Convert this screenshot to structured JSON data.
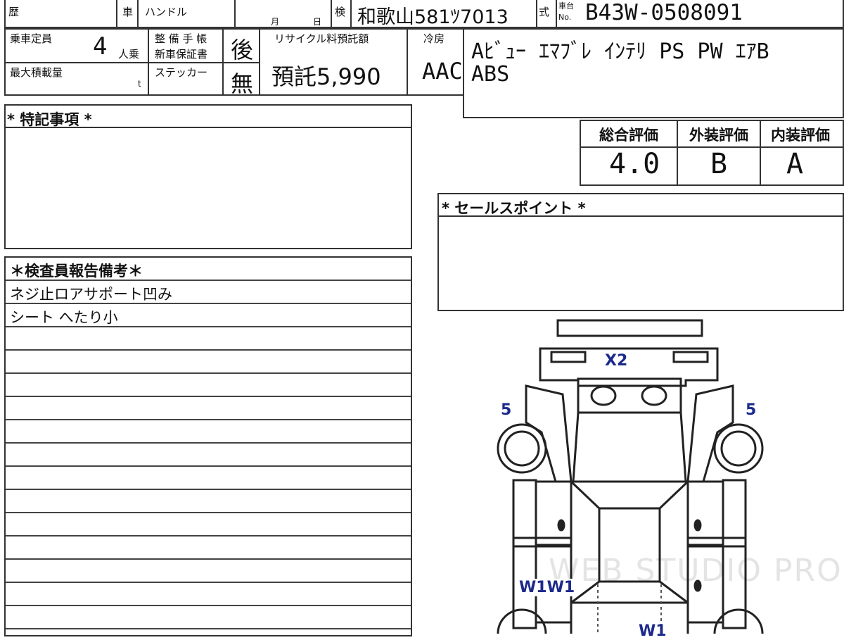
{
  "header": {
    "rireki_label": "歴",
    "car_label": "車",
    "handle_label": "ハンドル",
    "month_label": "月",
    "day_label": "日",
    "ken_label": "検",
    "plate": "和歌山581ﾂ7013",
    "shiki_label": "式",
    "chassis_label_top": "車台",
    "chassis_label_bottom": "No.",
    "chassis_no": "B43W-0508091"
  },
  "specs": {
    "capacity_label": "乗車定員",
    "capacity_value": "4",
    "capacity_unit": "人乗",
    "load_label": "最大積載量",
    "load_unit": "t",
    "maint_label_1": "整 備 手 帳",
    "maint_label_2": "新車保証書",
    "maint_value": "後",
    "sticker_label": "ステッカー",
    "sticker_value": "無",
    "recycle_label": "リサイクル料預託額",
    "recycle_value": "預託5,990",
    "aircon_label": "冷房",
    "aircon_value": "AAC"
  },
  "equipment": {
    "line1": "Aﾋﾞｭｰ ｴﾏﾌﾞﾚ ｲﾝﾃﾘ PS PW ｴｱB",
    "line2": "ABS"
  },
  "special_notes": {
    "title": "* 特記事項 *"
  },
  "ratings": {
    "overall_label": "総合評価",
    "exterior_label": "外装評価",
    "interior_label": "内装評価",
    "overall_value": "4.0",
    "exterior_value": "B",
    "interior_value": "A"
  },
  "sales_point": {
    "title": "* セールスポイント *"
  },
  "inspector": {
    "title": "＊検査員報告備考＊",
    "lines": [
      "ネジ止ロアサポート凹み",
      "シート へたり小"
    ]
  },
  "diagram": {
    "marks": {
      "front_center": "X2",
      "left_fender": "5",
      "right_fender": "5",
      "left_door": "W1W1",
      "bottom_center": "W1"
    },
    "mark_color": "#1c2a8c"
  },
  "watermark": "WEB STUDIO PRO"
}
